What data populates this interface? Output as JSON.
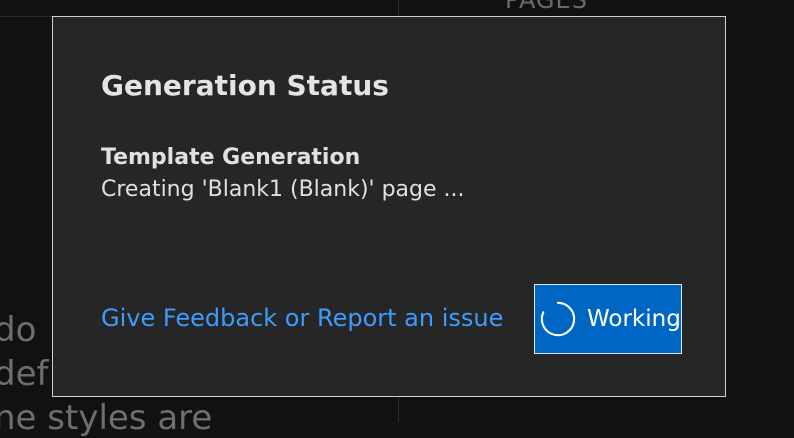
{
  "background": {
    "heading": "PAGES",
    "text_lines": [
      "do",
      "def",
      "ne styles are"
    ]
  },
  "dialog": {
    "title": "Generation Status",
    "section_title": "Template Generation",
    "status_text": "Creating 'Blank1 (Blank)' page ...",
    "feedback_link": "Give Feedback or Report an issue",
    "working_button": {
      "label": "Working",
      "icon": "spinner-icon"
    }
  },
  "colors": {
    "dialog_bg": "#262626",
    "link": "#3d9bff",
    "button_bg": "#0066c4"
  }
}
